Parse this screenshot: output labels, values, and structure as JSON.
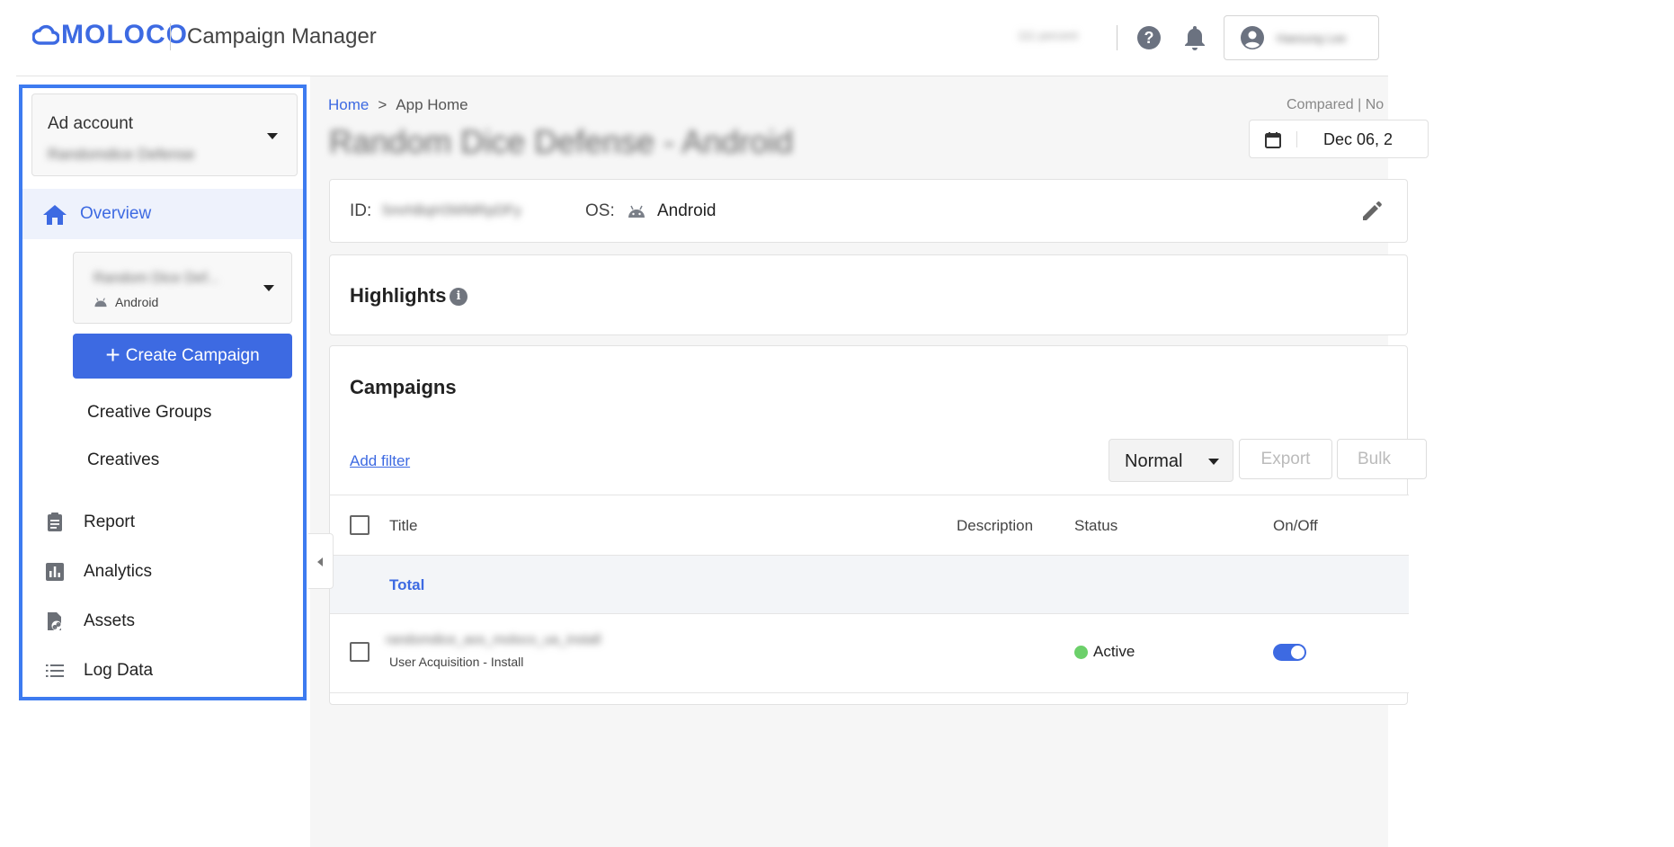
{
  "brand": {
    "logo_text": "MOLOCO",
    "app_title": "Campaign Manager",
    "accent": "#3d6ae2"
  },
  "topbar": {
    "user_percent": "111 percent",
    "user_name": "Haesung Lee"
  },
  "sidebar": {
    "ad_account_label": "Ad account",
    "ad_account_value": "Randomdice Defense",
    "overview_label": "Overview",
    "app_name": "Random Dice Def...",
    "app_os": "Android",
    "create_campaign_label": "Create Campaign",
    "sub_items": [
      "Creative Groups",
      "Creatives"
    ],
    "nav_items": [
      "Report",
      "Analytics",
      "Assets",
      "Log Data"
    ]
  },
  "breadcrumb": {
    "home": "Home",
    "sep": ">",
    "current": "App Home"
  },
  "header": {
    "compared_text": "Compared | No",
    "page_title": "Random Dice Defense - Android",
    "date": "Dec 06, 2"
  },
  "app_info": {
    "id_label": "ID:",
    "id_value": "5mrhBqH3WMRpDFy",
    "os_label": "OS:",
    "os_value": "Android"
  },
  "highlights": {
    "title": "Highlights",
    "info": "i"
  },
  "campaigns": {
    "title": "Campaigns",
    "add_filter": "Add filter",
    "view_select": "Normal",
    "export_label": "Export",
    "bulk_label": "Bulk",
    "columns": [
      "Title",
      "Description",
      "Status",
      "On/Off"
    ],
    "total_label": "Total",
    "rows": [
      {
        "name": "randomdice_aos_moloco_ua_install",
        "type": "User Acquisition - Install",
        "status": "Active",
        "status_color": "#6cd06a",
        "enabled": true
      }
    ]
  }
}
